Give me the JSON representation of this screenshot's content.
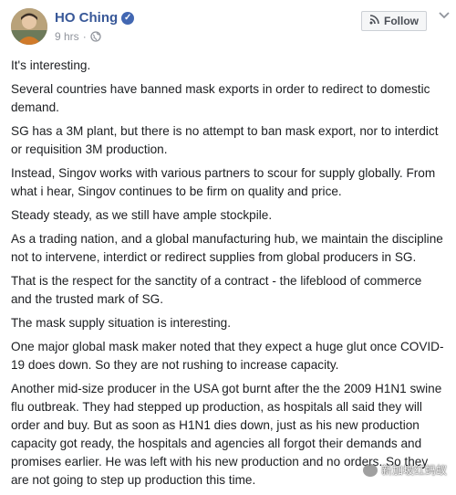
{
  "post": {
    "author": "HO Ching",
    "time": "9 hrs",
    "time_separator": "·",
    "follow_label": "Follow",
    "paragraphs": [
      "It's interesting.",
      "Several countries have banned mask exports in order to redirect to domestic demand.",
      "SG has a 3M plant, but there is no attempt to ban mask export, nor to interdict or requisition 3M production.",
      "Instead, Singov works with various partners to scour for supply globally. From what i hear, Singov continues to be firm on quality and price.",
      "Steady steady, as we still have ample stockpile.",
      "As a trading nation, and a global manufacturing hub, we maintain the discipline not to intervene, interdict or redirect supplies from global producers in SG.",
      "That is the respect for the sanctity of a contract - the lifeblood of commerce and the trusted mark of SG.",
      "The mask supply situation is interesting.",
      "One major global mask maker noted that they expect a huge glut once COVID-19 does down. So they are not rushing to increase capacity.",
      "Another mid-size producer in the USA got burnt after the the 2009 H1N1 swine flu outbreak. They had stepped up production, as hospitals all said they will order and buy. But as soon as H1N1 dies down, just as his new production capacity got ready, the hospitals and agencies all forgot their demands and promises earlier. He was left with his new production and no orders. So they are not going to step up production this time."
    ]
  },
  "icons": {
    "verified": "verified-badge-icon",
    "globe": "globe-icon",
    "follow": "rss-follow-icon",
    "chevron": "chevron-down-icon"
  },
  "watermark": {
    "text": "新加坡红蚂蚁"
  },
  "colors": {
    "author_name": "#385898",
    "meta": "#90949c",
    "text": "#1c1e21",
    "verified": "#4267b2"
  }
}
